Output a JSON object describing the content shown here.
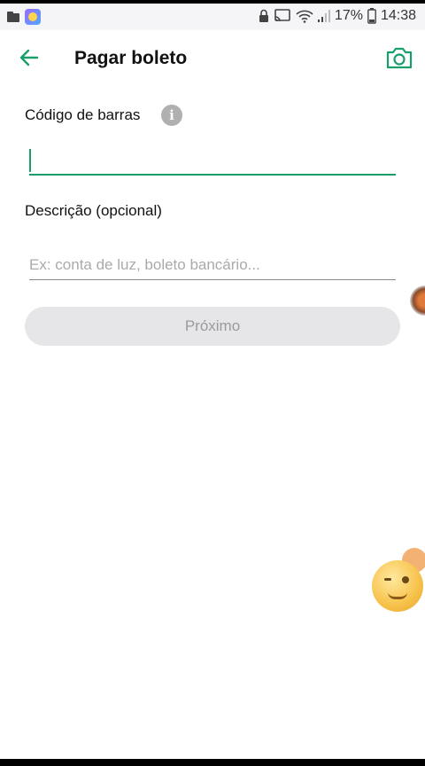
{
  "status_bar": {
    "battery_percent": "17%",
    "time": "14:38"
  },
  "header": {
    "title": "Pagar boleto"
  },
  "form": {
    "barcode_label": "Código de barras",
    "barcode_value": "",
    "info_symbol": "i",
    "description_label": "Descrição (opcional)",
    "description_placeholder": "Ex: conta de luz, boleto bancário...",
    "description_value": ""
  },
  "actions": {
    "next_label": "Próximo"
  },
  "colors": {
    "accent": "#1a9e6a",
    "disabled_button_bg": "#e6e6e8",
    "disabled_button_text": "#9a9a9a"
  },
  "icons": [
    "folder-icon",
    "app-icon",
    "lock-icon",
    "cast-icon",
    "wifi-icon",
    "signal-icon",
    "battery-icon",
    "back-arrow-icon",
    "camera-icon",
    "info-icon"
  ]
}
